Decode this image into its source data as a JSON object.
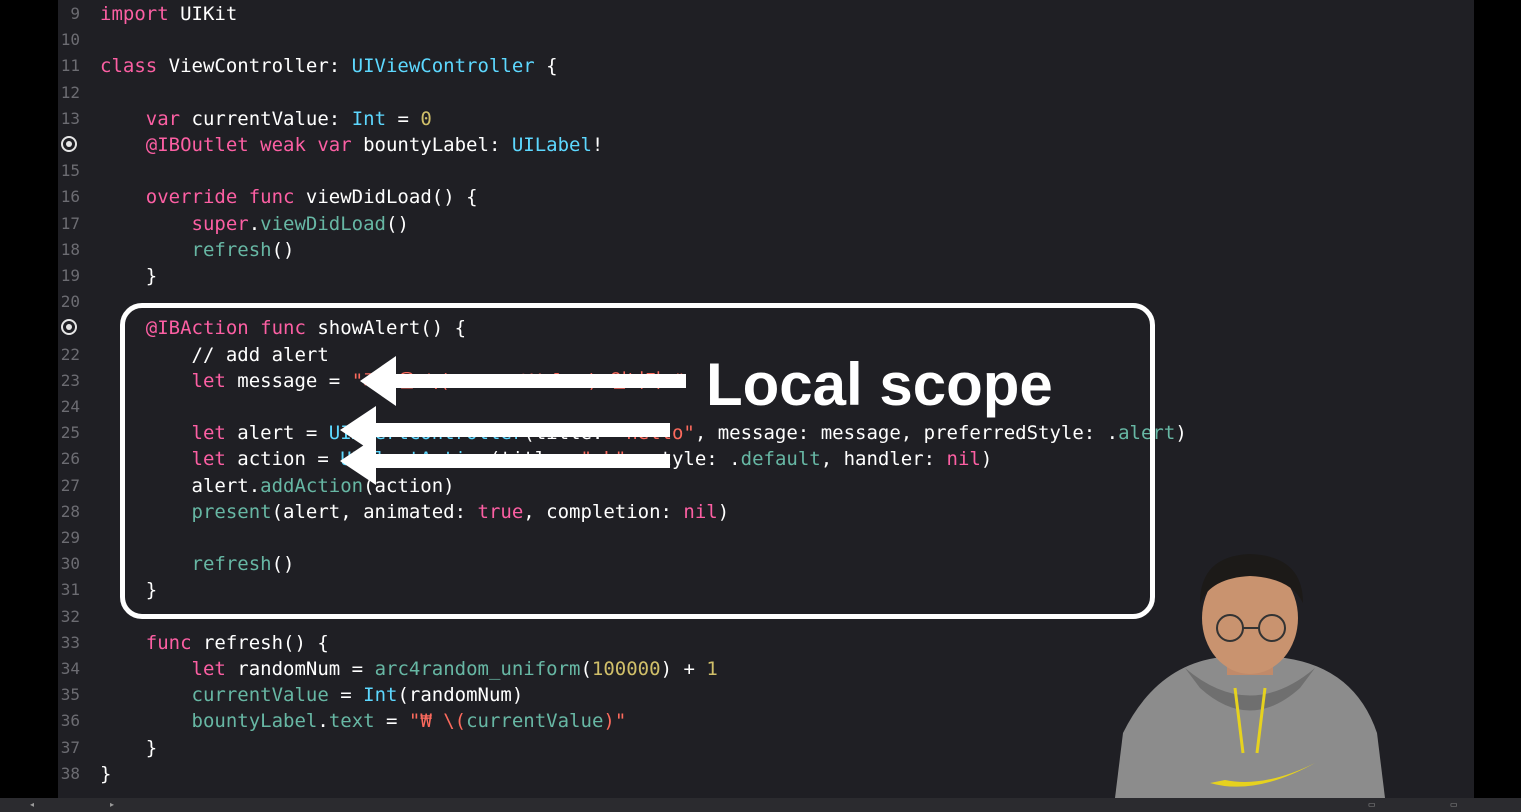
{
  "code_lines": [
    {
      "ln": "9",
      "segs": [
        [
          "kw",
          "import"
        ],
        [
          "p",
          " UIKit"
        ]
      ]
    },
    {
      "ln": "10",
      "segs": []
    },
    {
      "ln": "11",
      "segs": [
        [
          "kw",
          "class"
        ],
        [
          "p",
          " ViewController: "
        ],
        [
          "ty",
          "UIViewController"
        ],
        [
          "p",
          " {"
        ]
      ]
    },
    {
      "ln": "12",
      "segs": []
    },
    {
      "ln": "13",
      "segs": [
        [
          "p",
          "    "
        ],
        [
          "kw",
          "var"
        ],
        [
          "p",
          " currentValue: "
        ],
        [
          "ty",
          "Int"
        ],
        [
          "p",
          " = "
        ],
        [
          "num",
          "0"
        ]
      ]
    },
    {
      "ln": "14",
      "segs": [
        [
          "p",
          "    "
        ],
        [
          "kw",
          "@IBOutlet weak var"
        ],
        [
          "p",
          " bountyLabel: "
        ],
        [
          "ty",
          "UILabel"
        ],
        [
          "p",
          "!"
        ]
      ]
    },
    {
      "ln": "15",
      "segs": []
    },
    {
      "ln": "16",
      "segs": [
        [
          "p",
          "    "
        ],
        [
          "kw",
          "override func"
        ],
        [
          "p",
          " viewDidLoad() {"
        ]
      ]
    },
    {
      "ln": "17",
      "segs": [
        [
          "p",
          "        "
        ],
        [
          "kw",
          "super"
        ],
        [
          "p",
          "."
        ],
        [
          "fn",
          "viewDidLoad"
        ],
        [
          "p",
          "()"
        ]
      ]
    },
    {
      "ln": "18",
      "segs": [
        [
          "p",
          "        "
        ],
        [
          "fn",
          "refresh"
        ],
        [
          "p",
          "()"
        ]
      ]
    },
    {
      "ln": "19",
      "segs": [
        [
          "p",
          "    }"
        ]
      ]
    },
    {
      "ln": "20",
      "segs": []
    },
    {
      "ln": "21",
      "segs": [
        [
          "p",
          "    "
        ],
        [
          "kw",
          "@IBAction func"
        ],
        [
          "p",
          " showAlert() {"
        ]
      ]
    },
    {
      "ln": "22",
      "segs": [
        [
          "p",
          "        "
        ],
        [
          "cm2",
          "// add alert"
        ]
      ]
    },
    {
      "ln": "23",
      "segs": [
        [
          "p",
          "        "
        ],
        [
          "kw",
          "let"
        ],
        [
          "p",
          " message = "
        ],
        [
          "str",
          "\"가격은 \\(currentValue) 입니다.\""
        ]
      ]
    },
    {
      "ln": "24",
      "segs": []
    },
    {
      "ln": "25",
      "segs": [
        [
          "p",
          "        "
        ],
        [
          "kw",
          "let"
        ],
        [
          "p",
          " alert = "
        ],
        [
          "ty",
          "UIAlertController"
        ],
        [
          "p",
          "(title: "
        ],
        [
          "str",
          "\"hello\""
        ],
        [
          "p",
          ", message: message, preferredStyle: ."
        ],
        [
          "fn",
          "alert"
        ],
        [
          "p",
          ")"
        ]
      ]
    },
    {
      "ln": "26",
      "segs": [
        [
          "p",
          "        "
        ],
        [
          "kw",
          "let"
        ],
        [
          "p",
          " action = "
        ],
        [
          "ty",
          "UIAlertAction"
        ],
        [
          "p",
          "(title: "
        ],
        [
          "str",
          "\"ok\""
        ],
        [
          "p",
          ", style: ."
        ],
        [
          "fn",
          "default"
        ],
        [
          "p",
          ", handler: "
        ],
        [
          "kw",
          "nil"
        ],
        [
          "p",
          ")"
        ]
      ]
    },
    {
      "ln": "27",
      "segs": [
        [
          "p",
          "        alert."
        ],
        [
          "fn",
          "addAction"
        ],
        [
          "p",
          "(action)"
        ]
      ]
    },
    {
      "ln": "28",
      "segs": [
        [
          "p",
          "        "
        ],
        [
          "fn",
          "present"
        ],
        [
          "p",
          "(alert, animated: "
        ],
        [
          "kw",
          "true"
        ],
        [
          "p",
          ", completion: "
        ],
        [
          "kw",
          "nil"
        ],
        [
          "p",
          ")"
        ]
      ]
    },
    {
      "ln": "29",
      "segs": []
    },
    {
      "ln": "30",
      "segs": [
        [
          "p",
          "        "
        ],
        [
          "fn",
          "refresh"
        ],
        [
          "p",
          "()"
        ]
      ]
    },
    {
      "ln": "31",
      "segs": [
        [
          "p",
          "    }"
        ]
      ]
    },
    {
      "ln": "32",
      "segs": []
    },
    {
      "ln": "33",
      "segs": [
        [
          "p",
          "    "
        ],
        [
          "kw",
          "func"
        ],
        [
          "p",
          " refresh() {"
        ]
      ]
    },
    {
      "ln": "34",
      "segs": [
        [
          "p",
          "        "
        ],
        [
          "kw",
          "let"
        ],
        [
          "p",
          " randomNum = "
        ],
        [
          "fn",
          "arc4random_uniform"
        ],
        [
          "p",
          "("
        ],
        [
          "num",
          "100000"
        ],
        [
          "p",
          ") + "
        ],
        [
          "num",
          "1"
        ]
      ]
    },
    {
      "ln": "35",
      "segs": [
        [
          "p",
          "        "
        ],
        [
          "fn",
          "currentValue"
        ],
        [
          "p",
          " = "
        ],
        [
          "ty",
          "Int"
        ],
        [
          "p",
          "(randomNum)"
        ]
      ]
    },
    {
      "ln": "36",
      "segs": [
        [
          "p",
          "        "
        ],
        [
          "fn",
          "bountyLabel"
        ],
        [
          "p",
          "."
        ],
        [
          "fn",
          "text"
        ],
        [
          "p",
          " = "
        ],
        [
          "str",
          "\"₩ \\("
        ],
        [
          "fn",
          "currentValue"
        ],
        [
          "str",
          ")\""
        ]
      ]
    },
    {
      "ln": "37",
      "segs": [
        [
          "p",
          "    }"
        ]
      ]
    },
    {
      "ln": "38",
      "segs": [
        [
          "p",
          "}"
        ]
      ]
    }
  ],
  "breakpoint_lines": [
    "14",
    "21"
  ],
  "annotation": {
    "label": "Local scope"
  },
  "colors": {
    "keyword": "#fc5fa3",
    "type": "#5dd8ff",
    "function": "#67b7a4",
    "number": "#d0bf69",
    "string": "#fc6a5d",
    "comment": "#8bd35a",
    "annotation": "#ffffff"
  },
  "presenter": {
    "icon": "presenter-video-overlay"
  }
}
